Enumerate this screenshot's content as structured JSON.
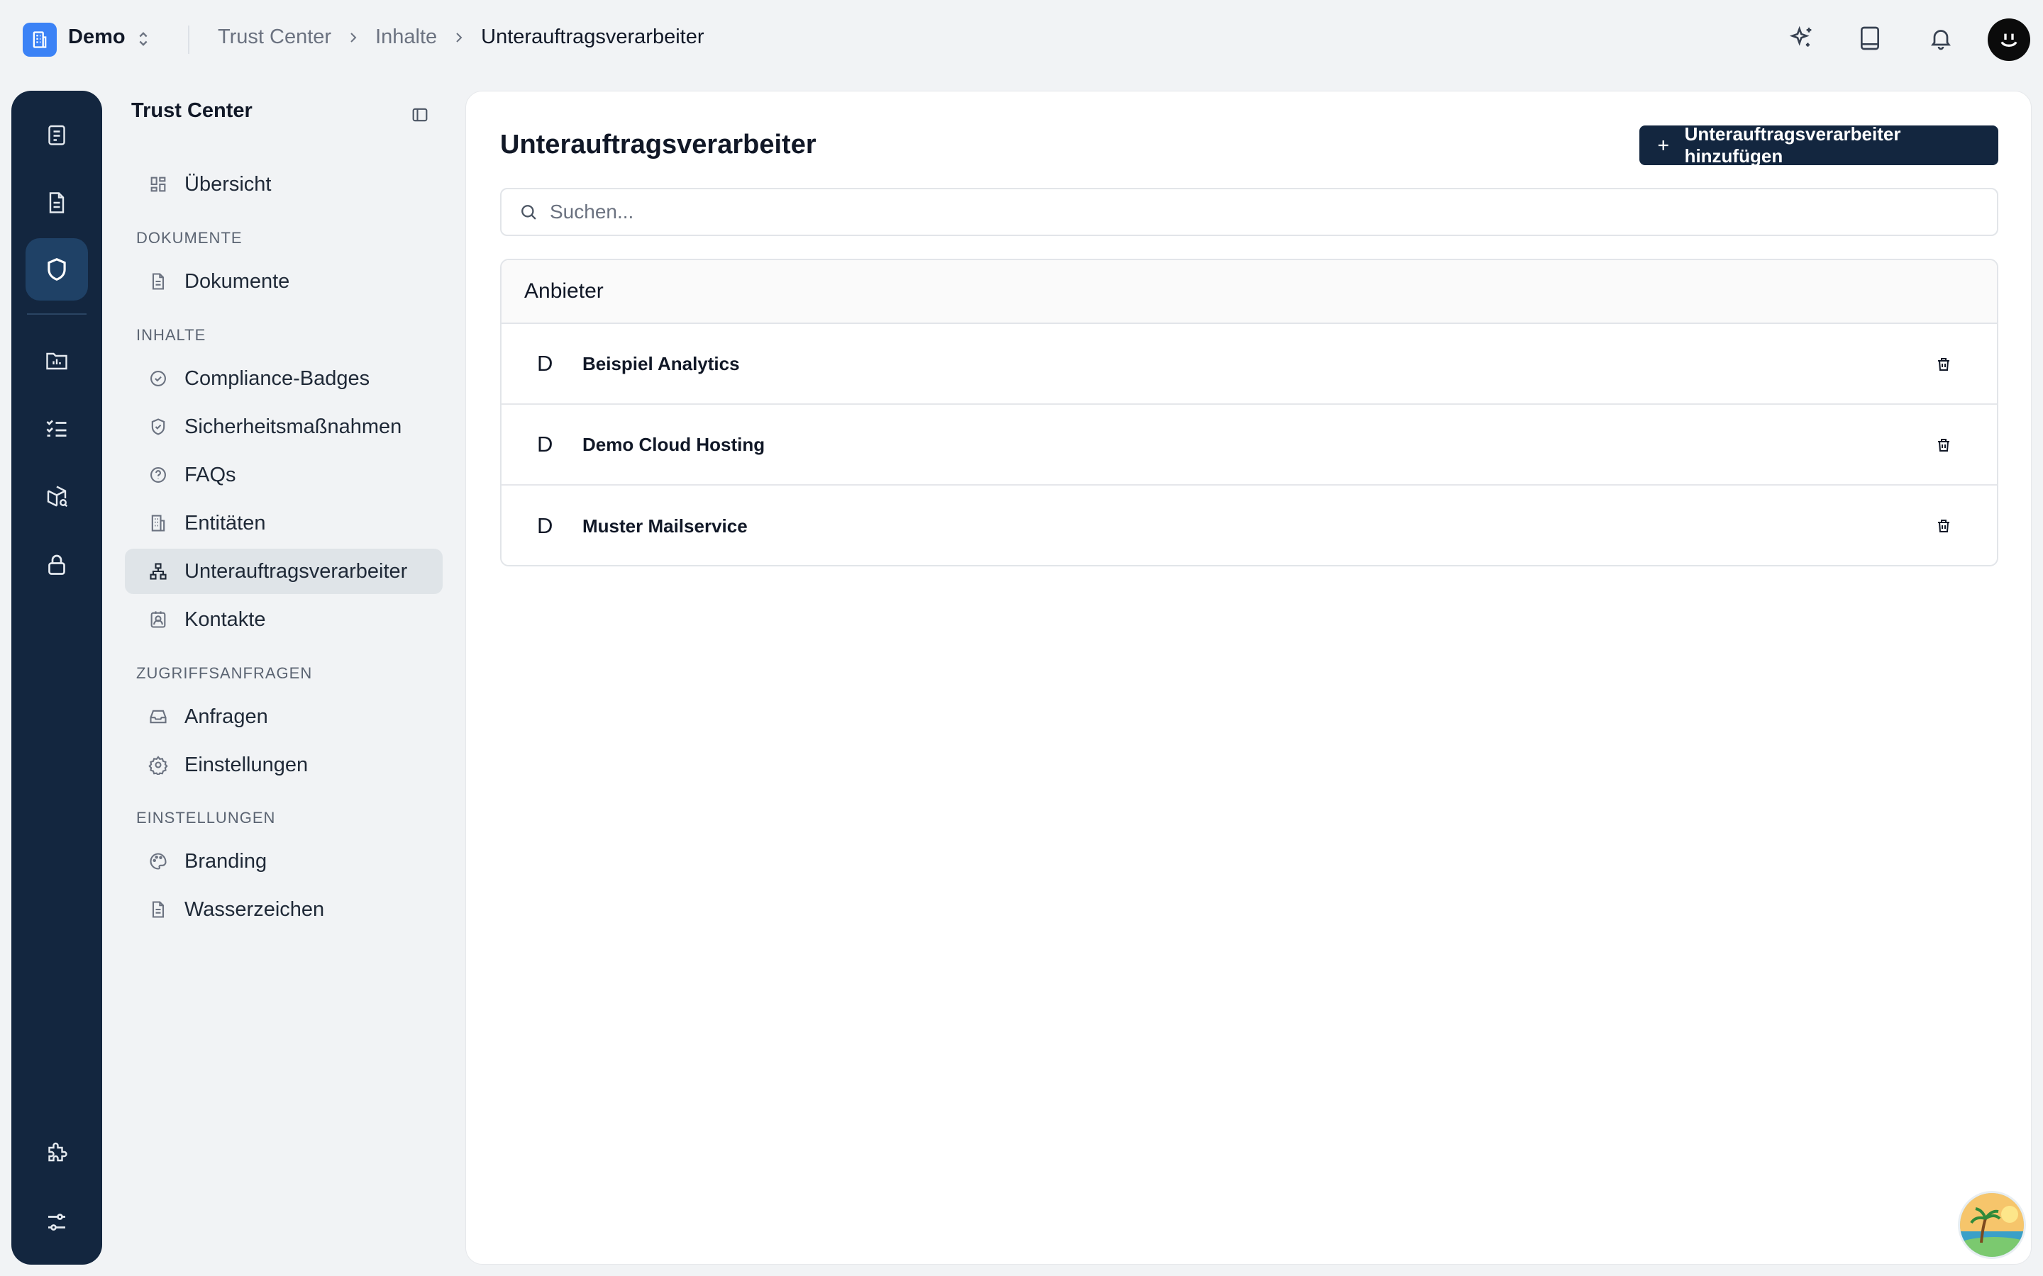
{
  "workspace": {
    "name": "Demo"
  },
  "breadcrumb": [
    "Trust Center",
    "Inhalte",
    "Unterauftragsverarbeiter"
  ],
  "sidebar": {
    "title": "Trust Center",
    "overview": "Übersicht",
    "sections": {
      "documents": "DOKUMENTE",
      "contents": "INHALTE",
      "access": "ZUGRIFFSANFRAGEN",
      "settings": "EINSTELLUNGEN"
    },
    "items": {
      "documents": "Dokumente",
      "badges": "Compliance-Badges",
      "security": "Sicherheitsmaßnahmen",
      "faqs": "FAQs",
      "entities": "Entitäten",
      "subprocessors": "Unterauftragsverarbeiter",
      "contacts": "Kontakte",
      "requests": "Anfragen",
      "access_settings": "Einstellungen",
      "branding": "Branding",
      "watermark": "Wasserzeichen"
    },
    "active": "subprocessors"
  },
  "main": {
    "title": "Unterauftragsverarbeiter",
    "add_button": "Unterauftragsverarbeiter hinzufügen",
    "search_placeholder": "Suchen...",
    "table_header": "Anbieter",
    "vendors": [
      {
        "initial": "D",
        "name": "Beispiel Analytics"
      },
      {
        "initial": "D",
        "name": "Demo Cloud Hosting"
      },
      {
        "initial": "D",
        "name": "Muster Mailservice"
      }
    ]
  },
  "icons": {
    "workspace": "building-icon",
    "topbar": [
      "sparkles-icon",
      "book-icon",
      "bell-icon"
    ],
    "rail": [
      "checklist-doc-icon",
      "document-icon",
      "shield-icon",
      "chart-folder-icon",
      "list-check-icon",
      "package-search-icon",
      "lock-icon",
      "puzzle-icon",
      "sliders-icon"
    ]
  },
  "colors": {
    "rail_bg": "#13263f",
    "rail_active": "#1f4166",
    "primary_button": "#13263f",
    "workspace_logo": "#3b82f6",
    "sidebar_active": "#dfe4e8"
  }
}
